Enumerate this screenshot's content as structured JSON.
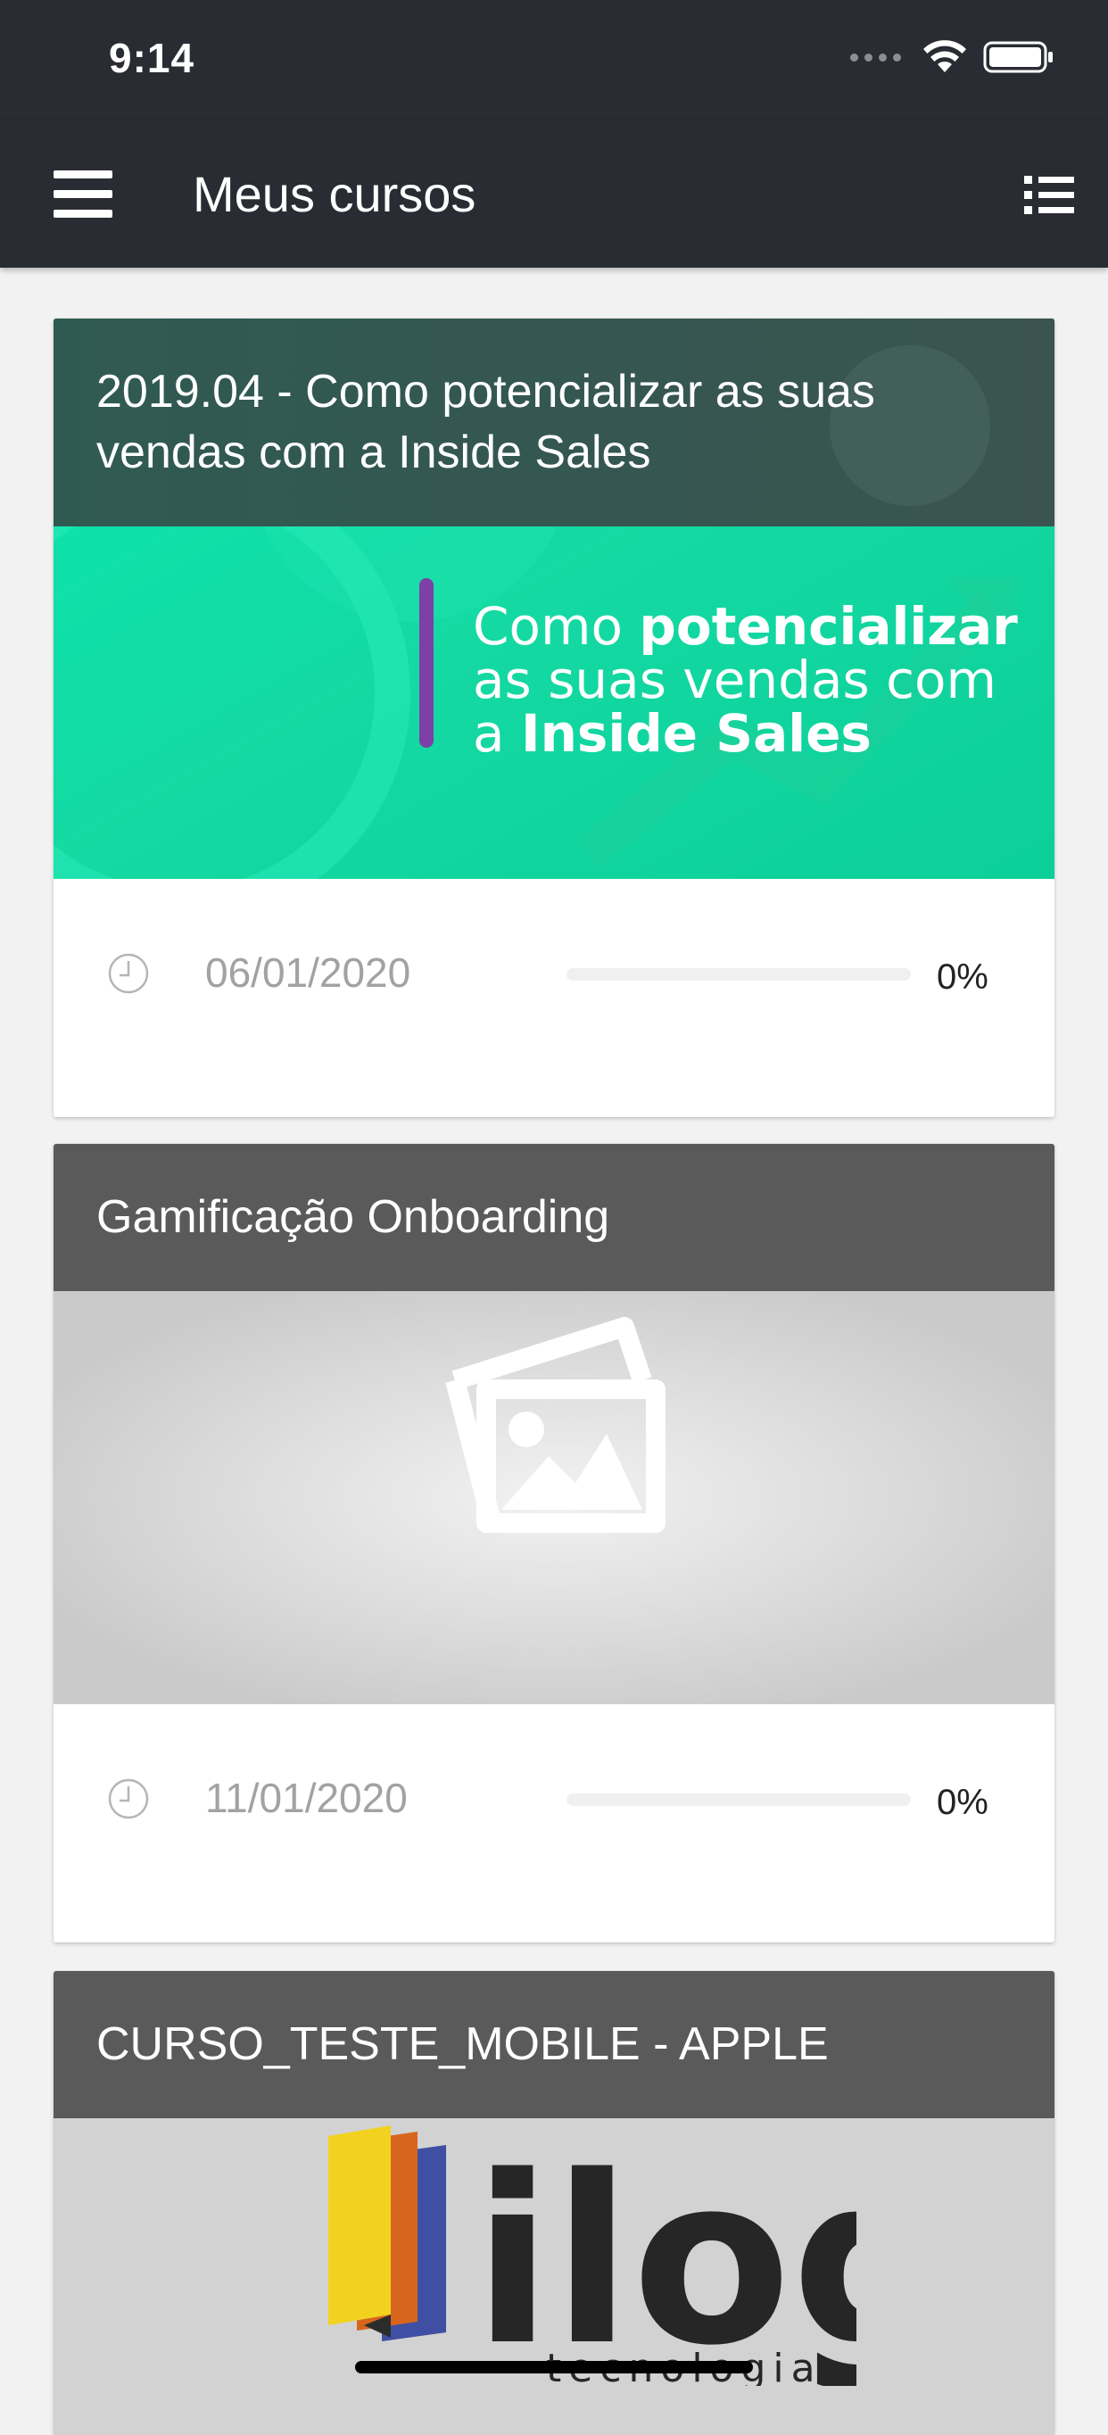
{
  "status_bar": {
    "time": "9:14"
  },
  "app_bar": {
    "title": "Meus cursos",
    "menu_icon": "hamburger-menu-icon",
    "view_icon": "list-view-icon"
  },
  "courses": [
    {
      "title": "2019.04 - Como potencializar as suas vendas com a Inside Sales",
      "banner": {
        "line1_regular": "Como ",
        "line1_bold": "potencializar",
        "line2": "as suas vendas com",
        "line3_regular": "a ",
        "line3_bold": "Inside Sales"
      },
      "date": "06/01/2020",
      "progress": 0,
      "progress_label": "0%"
    },
    {
      "title": "Gamificação Onboarding",
      "image": "placeholder-image-icon",
      "date": "11/01/2020",
      "progress": 0,
      "progress_label": "0%"
    },
    {
      "title": "CURSO_TESTE_MOBILE - APPLE",
      "logo": {
        "wordmark": "ilog",
        "tagline": "tecnologia"
      }
    }
  ],
  "colors": {
    "app_bar": "#292c32",
    "banner_green": "#0fd9a3",
    "header_dark_green": "#2f5a52",
    "header_gray": "#5a5a5a",
    "placeholder_bg": "#cfcfcf"
  }
}
